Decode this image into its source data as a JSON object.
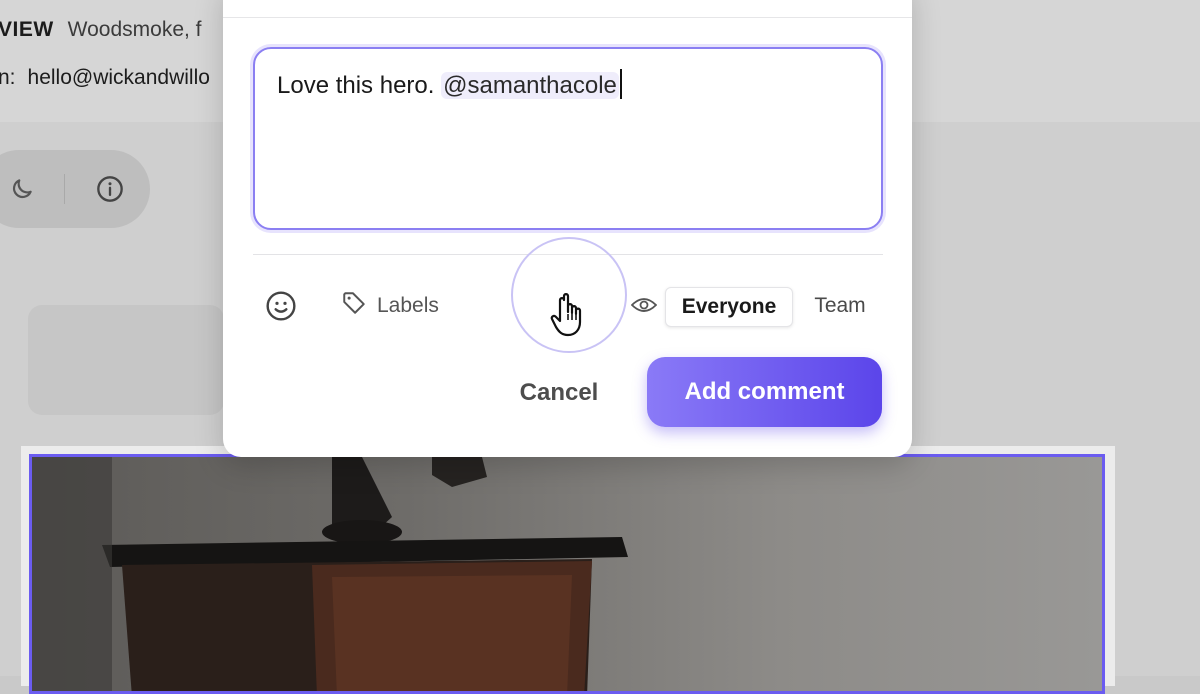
{
  "background": {
    "preview_label": "VIEW",
    "preview_value": "Woodsmoke, f",
    "email_label": "n:",
    "email_value": "hello@wickandwillo",
    "toolbar_icons": [
      "moon-icon",
      "info-icon"
    ]
  },
  "comment": {
    "text": "Love this hero. ",
    "mention": "@samanthacole"
  },
  "actions": {
    "emoji_icon": "smiley-icon",
    "labels_label": "Labels",
    "visibility_icon": "eye-icon",
    "visibility_options": [
      "Everyone",
      "Team"
    ],
    "visibility_selected": "Everyone",
    "cancel_label": "Cancel",
    "submit_label": "Add comment"
  },
  "colors": {
    "accent": "#6b5cf0",
    "button_gradient_start": "#8a7af7",
    "button_gradient_end": "#5b45ea",
    "mention_bg": "#efedfb"
  },
  "cursor": {
    "icon": "pointer-hand-icon"
  }
}
